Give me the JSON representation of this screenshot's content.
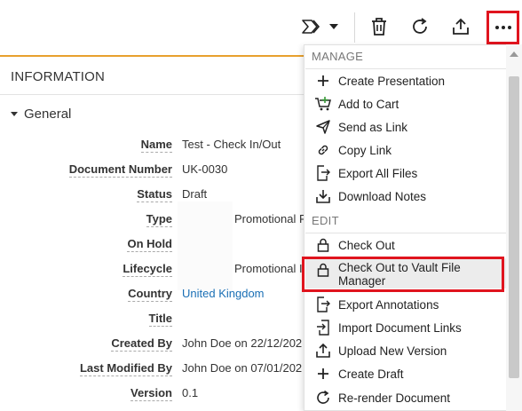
{
  "toolbar": {
    "icons": [
      "workflow-icon",
      "chevron-down-icon",
      "trash-icon",
      "refresh-icon",
      "upload-icon",
      "more-icon"
    ]
  },
  "info": {
    "header": "INFORMATION",
    "section": "General",
    "fields": [
      {
        "label": "Name",
        "value": "Test - Check In/Out"
      },
      {
        "label": "Document Number",
        "value": "UK-0030"
      },
      {
        "label": "Status",
        "value": "Draft"
      },
      {
        "label": "Type",
        "value": "Promotional P"
      },
      {
        "label": "On Hold",
        "value": ""
      },
      {
        "label": "Lifecycle",
        "value": "Promotional I"
      },
      {
        "label": "Country",
        "value": "United Kingdom"
      },
      {
        "label": "Title",
        "value": ""
      },
      {
        "label": "Created By",
        "value": "John Doe on 22/12/202"
      },
      {
        "label": "Last Modified By",
        "value": "John Doe on 07/01/202"
      },
      {
        "label": "Version",
        "value": "0.1"
      }
    ]
  },
  "menu": {
    "manage_label": "MANAGE",
    "edit_label": "EDIT",
    "manage_items": [
      {
        "label": "Create Presentation",
        "icon": "plus-icon"
      },
      {
        "label": "Add to Cart",
        "icon": "cart-add-icon"
      },
      {
        "label": "Send as Link",
        "icon": "send-icon"
      },
      {
        "label": "Copy Link",
        "icon": "link-icon"
      },
      {
        "label": "Export All Files",
        "icon": "export-icon"
      },
      {
        "label": "Download Notes",
        "icon": "download-icon"
      }
    ],
    "edit_items": [
      {
        "label": "Check Out",
        "icon": "lock-icon"
      },
      {
        "label": "Check Out to Vault File Manager",
        "icon": "lock-icon"
      },
      {
        "label": "Export Annotations",
        "icon": "export-icon"
      },
      {
        "label": "Import Document Links",
        "icon": "import-icon"
      },
      {
        "label": "Upload New Version",
        "icon": "upload-icon"
      },
      {
        "label": "Create Draft",
        "icon": "plus-icon"
      },
      {
        "label": "Re-render Document",
        "icon": "refresh-icon"
      }
    ]
  },
  "colors": {
    "accent_orange": "#e8a02e",
    "highlight_red": "#e0141e",
    "link_blue": "#1a6fb5"
  }
}
